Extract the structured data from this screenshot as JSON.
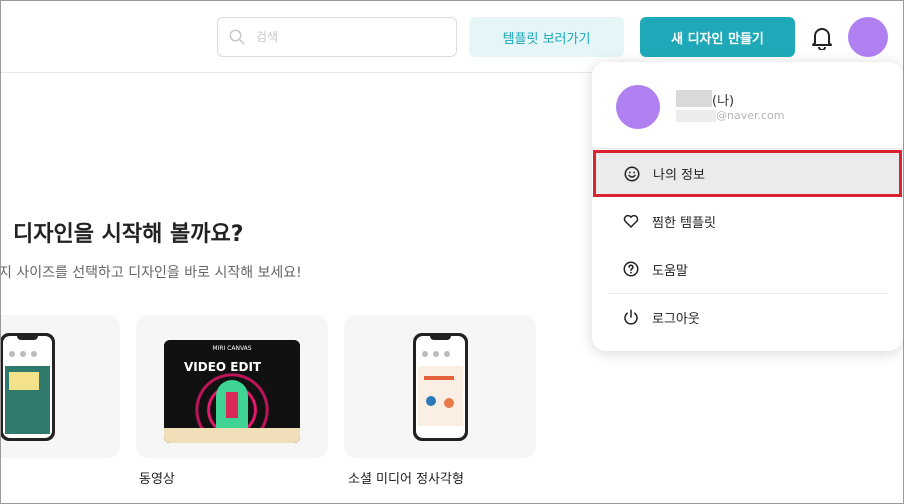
{
  "header": {
    "search_placeholder": "검색",
    "template_button": "템플릿 보러가기",
    "new_design_button": "새 디자인 만들기"
  },
  "main": {
    "heading": "디자인을 시작해 볼까요?",
    "subheading": "지 사이즈를 선택하고 디자인을 바로 시작해 보세요!",
    "cards": [
      {
        "label": ""
      },
      {
        "label": "동영상",
        "thumb_title": "VIDEO EDIT",
        "thumb_badge": "MIRI CANVAS"
      },
      {
        "label": "소셜 미디어 정사각형"
      }
    ]
  },
  "dropdown": {
    "user_name_suffix": "(나)",
    "email_domain": "@naver.com",
    "items": [
      {
        "label": "나의 정보",
        "icon": "smile-icon"
      },
      {
        "label": "찜한 템플릿",
        "icon": "heart-icon"
      },
      {
        "label": "도움말",
        "icon": "help-icon"
      },
      {
        "label": "로그아웃",
        "icon": "power-icon"
      }
    ]
  },
  "colors": {
    "accent": "#1fa9b8",
    "accent_light": "#e6f6f8",
    "avatar": "#b07ff0",
    "highlight_border": "#d9232e"
  }
}
